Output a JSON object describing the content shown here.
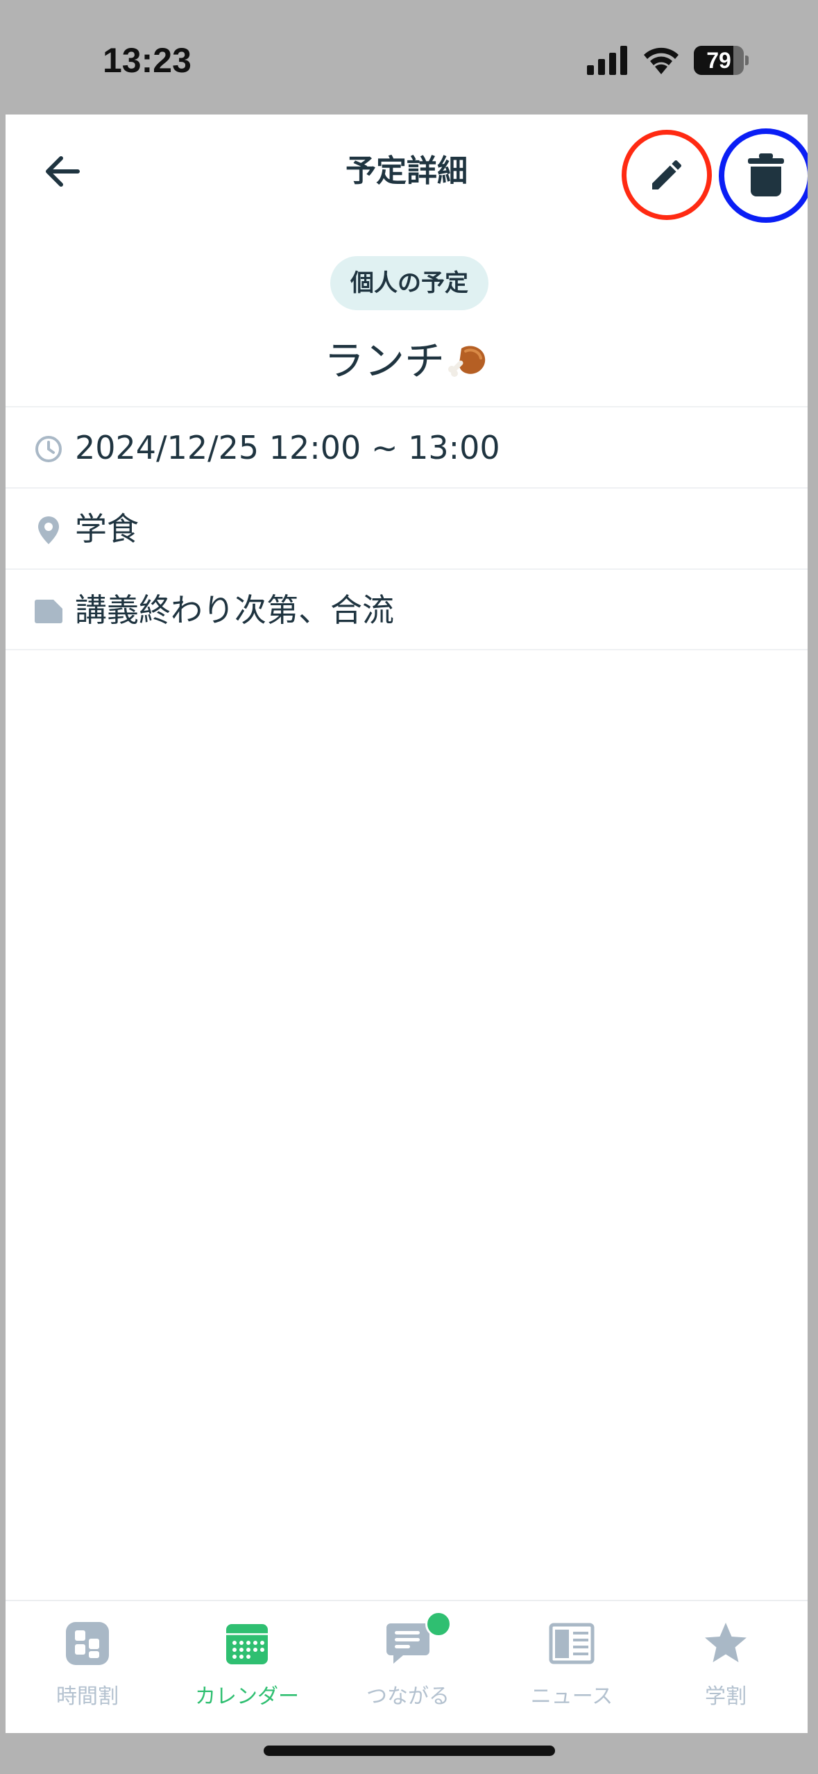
{
  "status_bar": {
    "time": "13:23",
    "battery_level": "79",
    "battery_fraction": 0.79
  },
  "header": {
    "title": "予定詳細",
    "back_icon": "arrow-left-icon",
    "edit_icon": "pencil-icon",
    "delete_icon": "trash-icon",
    "edit_highlight_color": "#ff2a12",
    "delete_highlight_color": "#0a1ef5"
  },
  "event": {
    "category_badge": "個人の予定",
    "title": "ランチ",
    "title_emoji_icon": "poultry-leg-icon",
    "details": [
      {
        "icon": "clock-icon",
        "text": "2024/12/25 12:00 ~ 13:00"
      },
      {
        "icon": "location-pin-icon",
        "text": "学食"
      },
      {
        "icon": "note-icon",
        "text": "講義終わり次第、合流"
      }
    ]
  },
  "tabbar": {
    "active_color": "#2fbf71",
    "inactive_color": "#b3c1cf",
    "items": [
      {
        "label": "時間割",
        "icon": "timetable-icon",
        "active": false
      },
      {
        "label": "カレンダー",
        "icon": "calendar-icon",
        "active": true
      },
      {
        "label": "つながる",
        "icon": "chat-icon",
        "active": false,
        "badge": true
      },
      {
        "label": "ニュース",
        "icon": "news-icon",
        "active": false
      },
      {
        "label": "学割",
        "icon": "star-icon",
        "active": false
      }
    ]
  }
}
